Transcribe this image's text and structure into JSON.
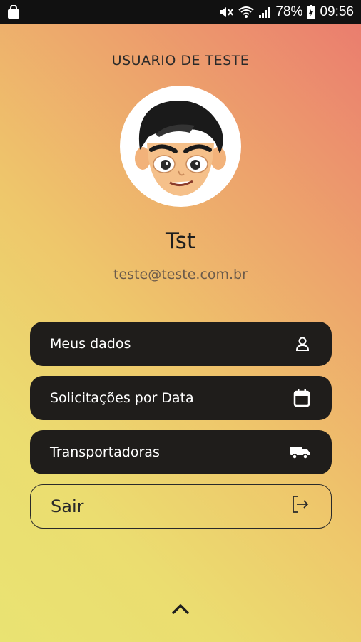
{
  "status_bar": {
    "battery_percent": "78%",
    "time": "09:56",
    "icons": [
      "bag-icon",
      "mute-icon",
      "wifi-icon",
      "signal-icon",
      "battery-icon"
    ]
  },
  "header": {
    "title": "USUARIO DE TESTE"
  },
  "profile": {
    "avatar": "cartoon-boy-avatar",
    "name": "Tst",
    "email": "teste@teste.com.br"
  },
  "menu": {
    "items": [
      {
        "label": "Meus dados",
        "icon": "user-icon"
      },
      {
        "label": "Solicitações por Data",
        "icon": "calendar-icon"
      },
      {
        "label": "Transportadoras",
        "icon": "truck-icon"
      }
    ],
    "logout": {
      "label": "Sair",
      "icon": "logout-icon"
    }
  },
  "footer": {
    "icon": "chevron-up-icon"
  },
  "colors": {
    "button_bg": "#1f1d1b",
    "gradient_top_right": "#ea7a6f",
    "gradient_bottom_left": "#e9e372"
  }
}
